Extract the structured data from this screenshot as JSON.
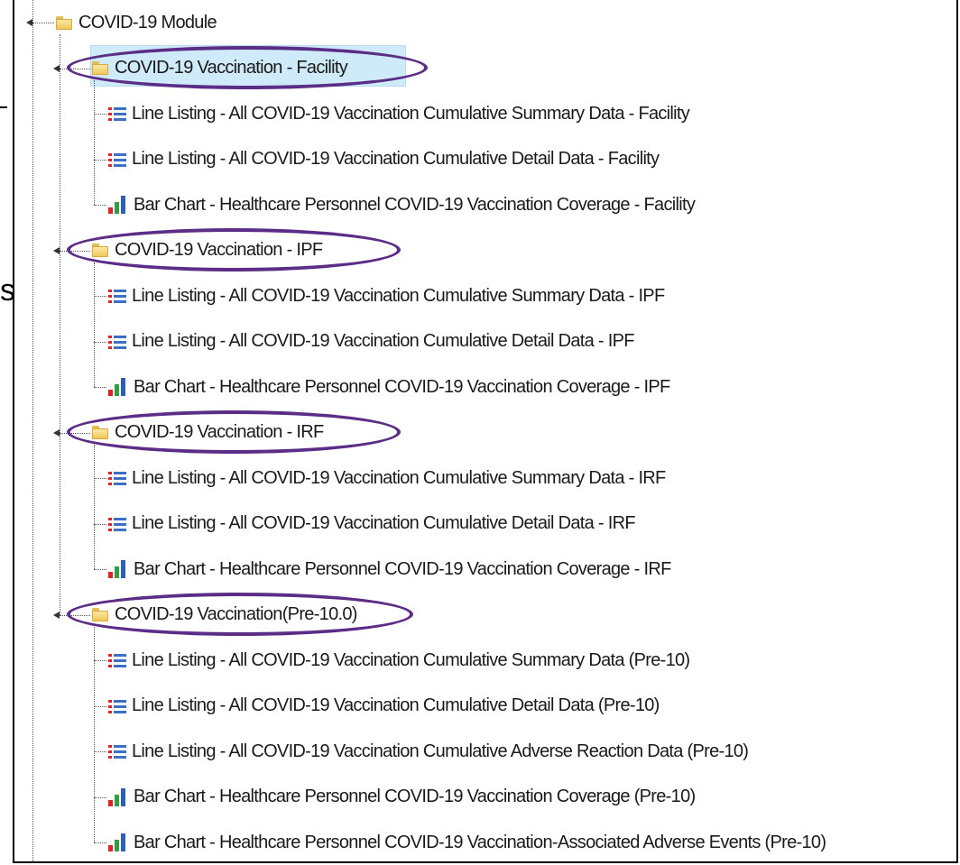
{
  "root": {
    "label": "COVID-19 Module"
  },
  "stray_glyph": "s",
  "groups": [
    {
      "label": "COVID-19 Vaccination - Facility",
      "selected": true,
      "circled": true,
      "items": [
        {
          "icon": "line-listing-icon",
          "label": "Line Listing - All COVID-19 Vaccination Cumulative Summary Data - Facility"
        },
        {
          "icon": "line-listing-icon",
          "label": "Line Listing - All COVID-19 Vaccination Cumulative Detail Data - Facility"
        },
        {
          "icon": "bar-chart-icon",
          "label": "Bar Chart - Healthcare Personnel COVID-19 Vaccination Coverage - Facility"
        }
      ]
    },
    {
      "label": "COVID-19 Vaccination - IPF",
      "circled": true,
      "items": [
        {
          "icon": "line-listing-icon",
          "label": "Line Listing - All COVID-19 Vaccination Cumulative Summary Data - IPF"
        },
        {
          "icon": "line-listing-icon",
          "label": "Line Listing - All COVID-19 Vaccination Cumulative Detail Data - IPF"
        },
        {
          "icon": "bar-chart-icon",
          "label": "Bar Chart - Healthcare Personnel COVID-19 Vaccination Coverage - IPF"
        }
      ]
    },
    {
      "label": "COVID-19 Vaccination - IRF",
      "circled": true,
      "items": [
        {
          "icon": "line-listing-icon",
          "label": "Line Listing - All COVID-19 Vaccination Cumulative Summary Data - IRF"
        },
        {
          "icon": "line-listing-icon",
          "label": "Line Listing - All COVID-19 Vaccination Cumulative Detail Data - IRF"
        },
        {
          "icon": "bar-chart-icon",
          "label": "Bar Chart - Healthcare Personnel COVID-19 Vaccination Coverage - IRF"
        }
      ]
    },
    {
      "label": "COVID-19 Vaccination(Pre-10.0)",
      "circled": true,
      "items": [
        {
          "icon": "line-listing-icon",
          "label": "Line Listing - All COVID-19 Vaccination Cumulative Summary Data (Pre-10)"
        },
        {
          "icon": "line-listing-icon",
          "label": "Line Listing - All COVID-19 Vaccination Cumulative Detail Data (Pre-10)"
        },
        {
          "icon": "line-listing-icon",
          "label": "Line Listing - All COVID-19 Vaccination Cumulative Adverse Reaction Data (Pre-10)"
        },
        {
          "icon": "bar-chart-icon",
          "label": "Bar Chart - Healthcare Personnel COVID-19 Vaccination Coverage (Pre-10)"
        },
        {
          "icon": "bar-chart-icon",
          "label": "Bar Chart - Healthcare Personnel COVID-19 Vaccination-Associated Adverse Events (Pre-10)"
        }
      ]
    }
  ],
  "colors": {
    "selection": "#cfeaf8",
    "ring": "#5b2d86",
    "list_bullet": "#d6262b",
    "list_line": "#3b6fc2",
    "bar_colors": [
      "#d6262b",
      "#2f9e44",
      "#2d5fb8"
    ]
  }
}
